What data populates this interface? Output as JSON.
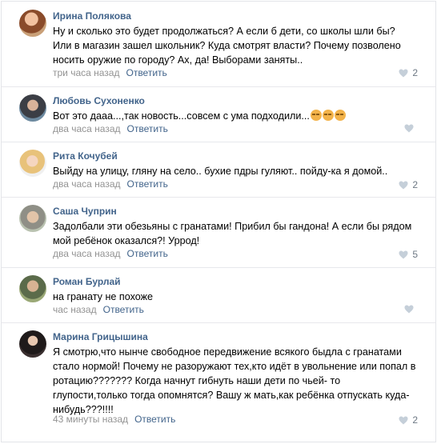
{
  "comments": [
    {
      "author": "Ирина Полякова",
      "text": "Ну и сколько это будет продолжаться? А если б дети, со школы шли бы? Или в магазин зашел школьник? Куда смотрят власти? Почему позволено носить оружие по городу? Ах, да! Выборами заняты..",
      "time": "три часа назад",
      "reply": "Ответить",
      "likes": "2"
    },
    {
      "author": "Любовь Сухоненко",
      "text": "Вот это дааа...,так новость...совсем с ума подходили...",
      "time": "два часа назад",
      "reply": "Ответить",
      "likes": ""
    },
    {
      "author": "Рита Кочубей",
      "text": "Выйду на улицу, гляну на село.. бухие пдры гуляют.. пойду-ка я домой..",
      "time": "два часа назад",
      "reply": "Ответить",
      "likes": "2"
    },
    {
      "author": "Саша Чуприн",
      "text": "Задолбали эти обезьяны с гранатами! Прибил бы гандона! А если бы рядом мой ребёнок оказался?! Уррод!",
      "time": "два часа назад",
      "reply": "Ответить",
      "likes": "5"
    },
    {
      "author": "Роман Бурлай",
      "text": "на гранату не похоже",
      "time": "час назад",
      "reply": "Ответить",
      "likes": ""
    },
    {
      "author": "Марина Грицышина",
      "text": "Я смотрю,что нынче свободное передвижение всякого быдла с гранатами стало нормой! Почему не разоружают тех,кто идёт в увольнение или попал в ротацию??????? Когда начнут гибнуть наши дети по чьей- то глупости,только тогда опомнятся? Вашу ж мать,как ребёнка отпускать куда- нибудь???!!!!",
      "time": "43 минуты назад",
      "reply": "Ответить",
      "likes": "2"
    }
  ],
  "colors": {
    "author": "#42648b",
    "meta": "#939393",
    "like_icon": "#c5cfd9",
    "divider": "#e7e8ec"
  }
}
